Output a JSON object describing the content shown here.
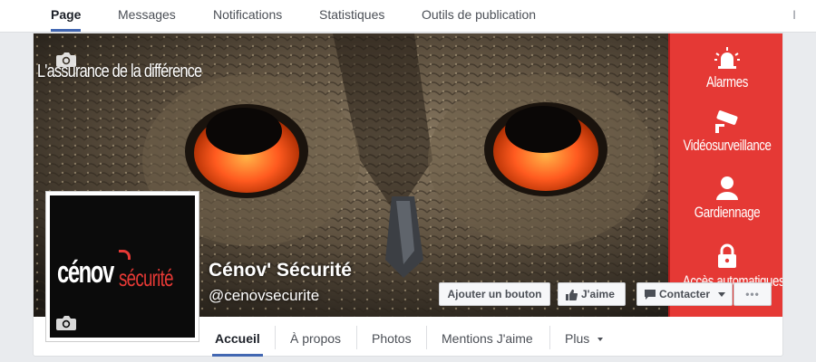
{
  "admin_tabs": {
    "items": [
      {
        "label": "Page",
        "active": true
      },
      {
        "label": "Messages"
      },
      {
        "label": "Notifications"
      },
      {
        "label": "Statistiques"
      },
      {
        "label": "Outils de publication"
      }
    ],
    "overflow_char": "I"
  },
  "cover": {
    "slogan": "L'assurance de la différence",
    "camera_icon": "camera-icon",
    "services": [
      "Alarmes",
      "Vidéosurveillance",
      "Gardiennage",
      "Accès automatiques"
    ],
    "colors": {
      "panel": "#e53935",
      "eyes": "#ff5a1f"
    }
  },
  "profile": {
    "logo_main": "cénov",
    "logo_accent": "sécurité",
    "camera_icon": "camera-icon"
  },
  "page": {
    "name": "Cénov' Sécurité",
    "handle": "@cenovsecurite"
  },
  "actions": {
    "add_button": "Ajouter un bouton",
    "like": "J'aime",
    "contact": "Contacter",
    "more": "•••"
  },
  "bottom_nav": {
    "items": [
      "Accueil",
      "À propos",
      "Photos",
      "Mentions J'aime",
      "Plus"
    ],
    "active": "Accueil"
  },
  "colors": {
    "accent": "#4267b2",
    "text": "#4b4f56"
  }
}
